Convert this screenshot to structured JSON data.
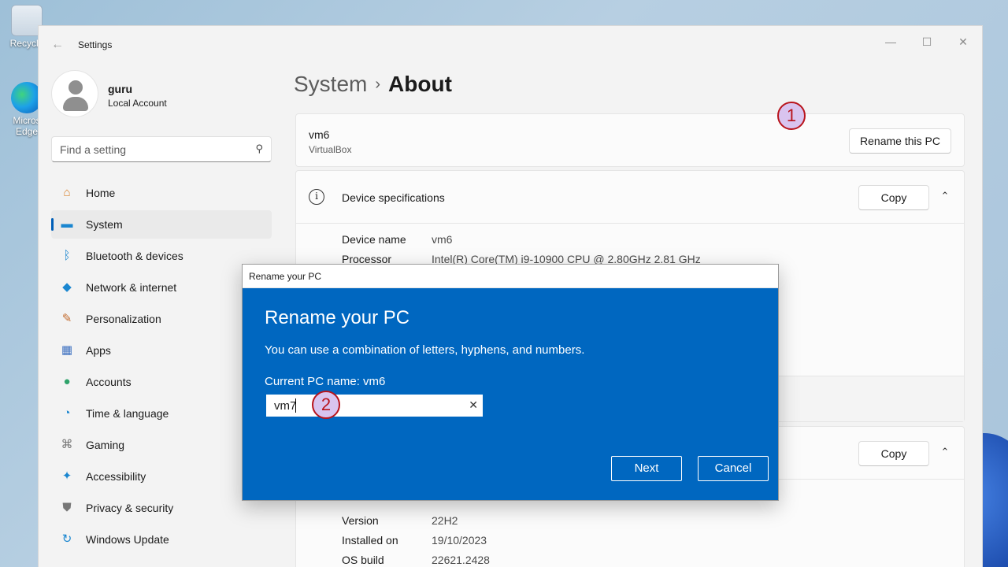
{
  "desktop": {
    "icons": [
      {
        "label": "Recycle",
        "icon": "recycle-bin-icon"
      },
      {
        "label": "Micros Edge",
        "icon": "edge-icon"
      }
    ]
  },
  "window": {
    "title": "Settings",
    "controls": {
      "minimize": "—",
      "maximize": "☐",
      "close": "✕"
    }
  },
  "user": {
    "name": "guru",
    "account_type": "Local Account"
  },
  "search": {
    "placeholder": "Find a setting"
  },
  "nav": {
    "items": [
      {
        "label": "Home",
        "icon": "home-icon"
      },
      {
        "label": "System",
        "icon": "system-icon",
        "active": true
      },
      {
        "label": "Bluetooth & devices",
        "icon": "bluetooth-icon"
      },
      {
        "label": "Network & internet",
        "icon": "wifi-icon"
      },
      {
        "label": "Personalization",
        "icon": "brush-icon"
      },
      {
        "label": "Apps",
        "icon": "apps-icon"
      },
      {
        "label": "Accounts",
        "icon": "accounts-icon"
      },
      {
        "label": "Time & language",
        "icon": "globe-clock-icon"
      },
      {
        "label": "Gaming",
        "icon": "gamepad-icon"
      },
      {
        "label": "Accessibility",
        "icon": "accessibility-icon"
      },
      {
        "label": "Privacy & security",
        "icon": "shield-icon"
      },
      {
        "label": "Windows Update",
        "icon": "update-icon"
      }
    ]
  },
  "breadcrumb": {
    "parent": "System",
    "separator": "›",
    "current": "About"
  },
  "pc": {
    "name": "vm6",
    "model": "VirtualBox",
    "rename_label": "Rename this PC"
  },
  "device_specs": {
    "title": "Device specifications",
    "copy_label": "Copy",
    "rows": [
      {
        "label": "Device name",
        "value": "vm6"
      },
      {
        "label": "Processor",
        "value": "Intel(R) Core(TM) i9-10900 CPU @ 2.80GHz   2.81 GHz"
      }
    ]
  },
  "windows_specs": {
    "copy_label": "Copy",
    "rows": [
      {
        "label": "Version",
        "value": "22H2"
      },
      {
        "label": "Installed on",
        "value": "19/10/2023"
      },
      {
        "label": "OS build",
        "value": "22621.2428"
      }
    ]
  },
  "annotations": {
    "one": "1",
    "two": "2"
  },
  "dialog": {
    "window_title": "Rename your PC",
    "heading": "Rename your PC",
    "description": "You can use a combination of letters, hyphens, and numbers.",
    "current_name": "Current PC name: vm6",
    "input_value": "vm7",
    "clear_glyph": "✕",
    "next_label": "Next",
    "cancel_label": "Cancel"
  },
  "colors": {
    "accent": "#0067c0",
    "annotation": "#b8141c",
    "annotation_fill": "#d9c4ef"
  }
}
